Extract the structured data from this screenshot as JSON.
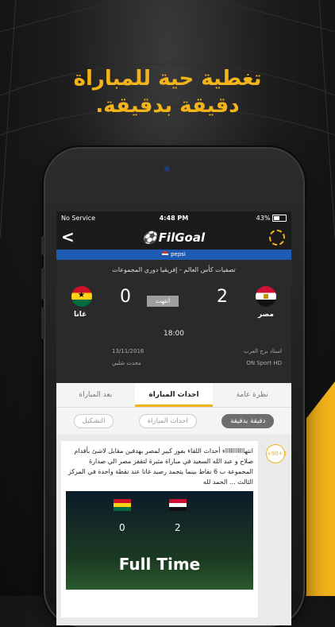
{
  "promo": {
    "line1": "تغطية حية للمباراة",
    "line2": "دقيقة بدقيقة."
  },
  "status_bar": {
    "carrier": "No Service",
    "time": "4:48 PM",
    "battery": "43%"
  },
  "navbar": {
    "back": "<",
    "logo_text": "FilGoal"
  },
  "sponsor": {
    "text": "pepsi"
  },
  "match": {
    "competition": "تصفيات كأس العالم - إفريقيا دوري المجموعات",
    "home_team": "مصر",
    "home_score": "2",
    "away_team": "غانا",
    "away_score": "0",
    "status": "انتهت",
    "kickoff": "18:00",
    "stadium": "استاد برج العرب",
    "date": "13/11/2016",
    "channel": "ON Sport HD",
    "updated": "محدث شلبي"
  },
  "tabs": [
    "نظرة عامة",
    "احداث المباراة",
    "بعد المباراة"
  ],
  "chips": [
    "دقيقة بدقيقة",
    "احداث المباراة",
    "التشكيل"
  ],
  "feed": {
    "minute_badge": "+90+3",
    "text": "انتهاااااااااااء أحداث اللقاء بفوز كبير لمصر بهدفين مقابل لاشئ بأقدام صلاح و عبد الله السعيد في مباراة مثيرة لتقفز مصر الي صدارة المجموعة ب 6 نقاط بينما يتجمد رصيد غانا عند نقطة واحدة في المركز الثالث ... الحمد لله",
    "image": {
      "home_score": "0",
      "away_score": "2",
      "caption": "Full Time",
      "label_left": "",
      "label_right": ""
    }
  },
  "colors": {
    "accent": "#f3b31a",
    "header": "#1b1b1b",
    "sponsor": "#1e5cb3"
  }
}
